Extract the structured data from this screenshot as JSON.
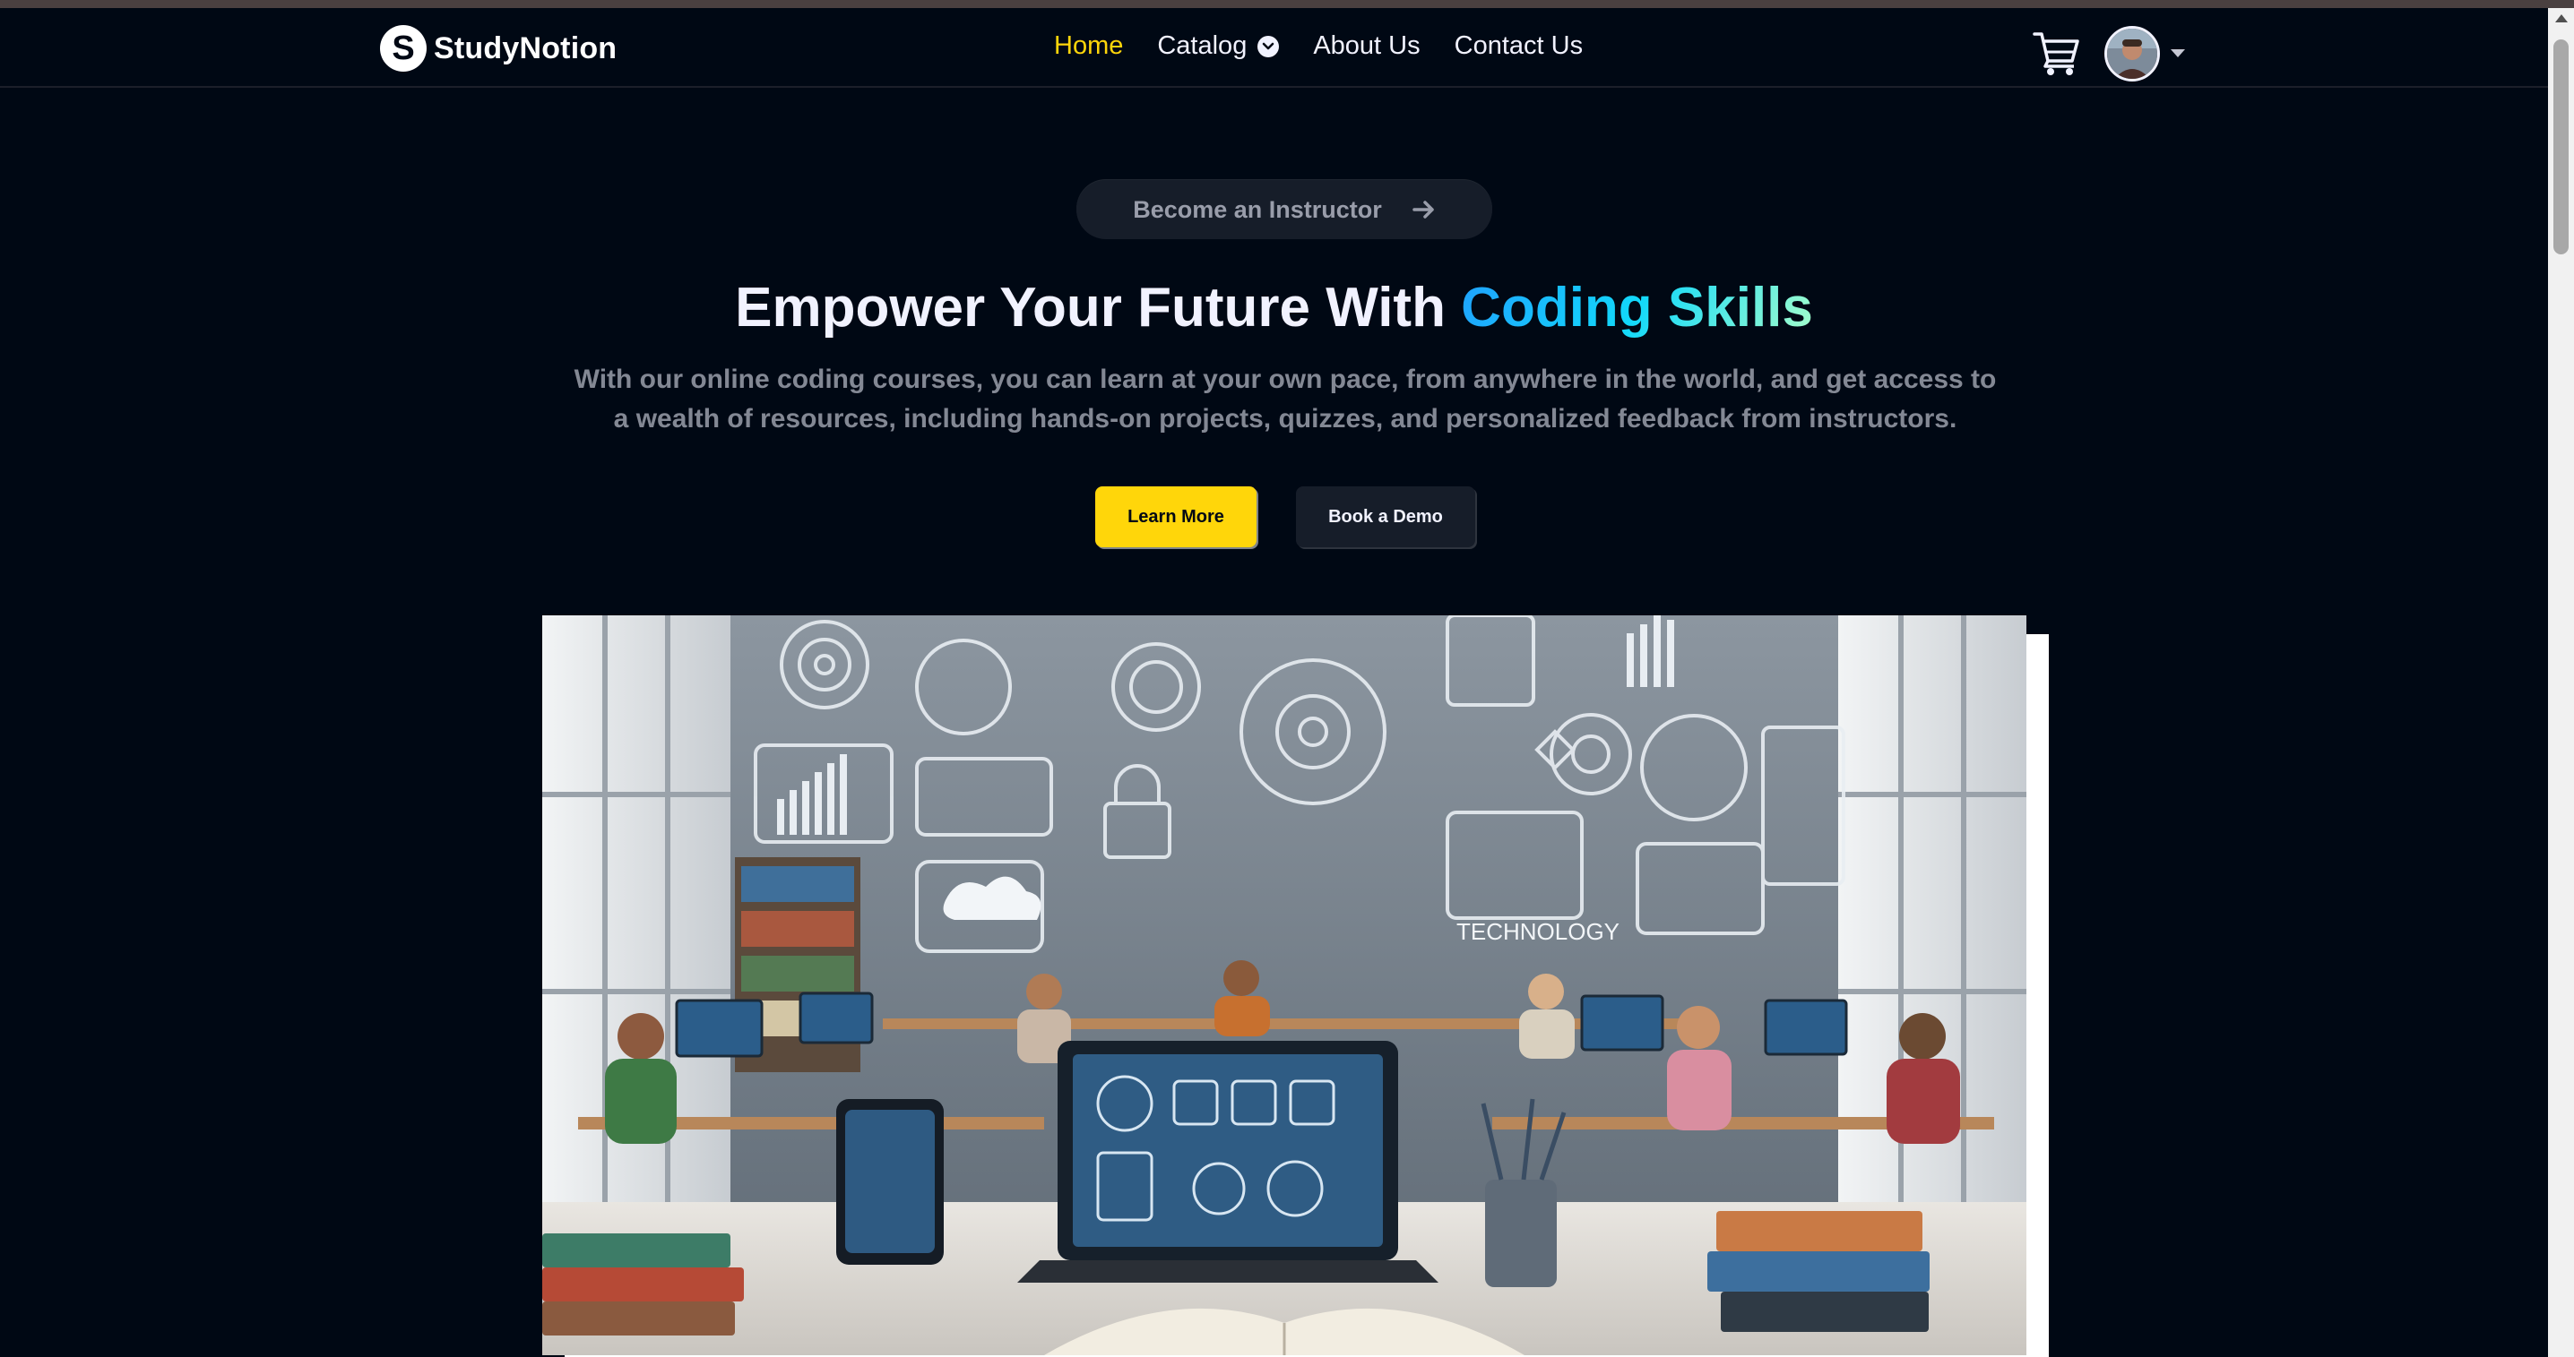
{
  "brand": {
    "logo_letter": "S",
    "name": "StudyNotion"
  },
  "nav": {
    "items": [
      {
        "label": "Home",
        "active": true
      },
      {
        "label": "Catalog",
        "dropdown": true
      },
      {
        "label": "About Us"
      },
      {
        "label": "Contact Us"
      }
    ],
    "cart_icon": "cart-icon",
    "avatar": "user-avatar"
  },
  "hero": {
    "instructor_button": "Become an Instructor",
    "headline_plain": "Empower Your Future With ",
    "headline_highlight": "Coding Skills",
    "description": "With our online coding courses, you can learn at your own pace, from anywhere in the world, and get access to a wealth of resources, including hands-on projects, quizzes, and personalized feedback from instructors.",
    "primary_button": "Learn More",
    "secondary_button": "Book a Demo",
    "image_label": "TECHNOLOGY"
  },
  "colors": {
    "background": "#000814",
    "accent_yellow": "#ffd60a",
    "gradient": [
      "#1fa2ff",
      "#12d8fa",
      "#a6ffcb"
    ]
  }
}
